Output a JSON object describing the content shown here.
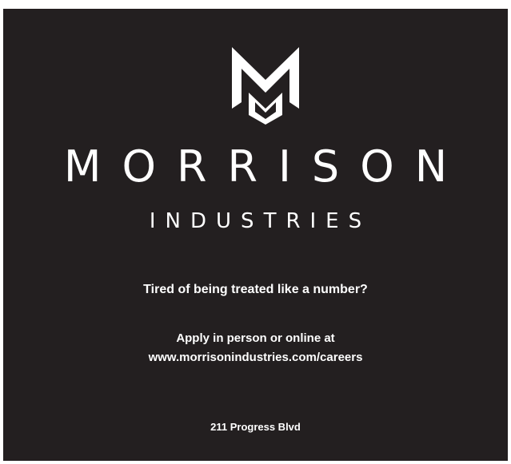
{
  "brand": {
    "logo_letters": "MM",
    "name": "MORRISON",
    "subtitle": "INDUSTRIES",
    "text_color": "#ffffff",
    "background_color": "#231f20"
  },
  "tagline": "Tired of being treated like a number?",
  "apply": {
    "line1": "Apply in person or online at",
    "url": "www.morrisonindustries.com/careers"
  },
  "address": "211 Progress Blvd"
}
